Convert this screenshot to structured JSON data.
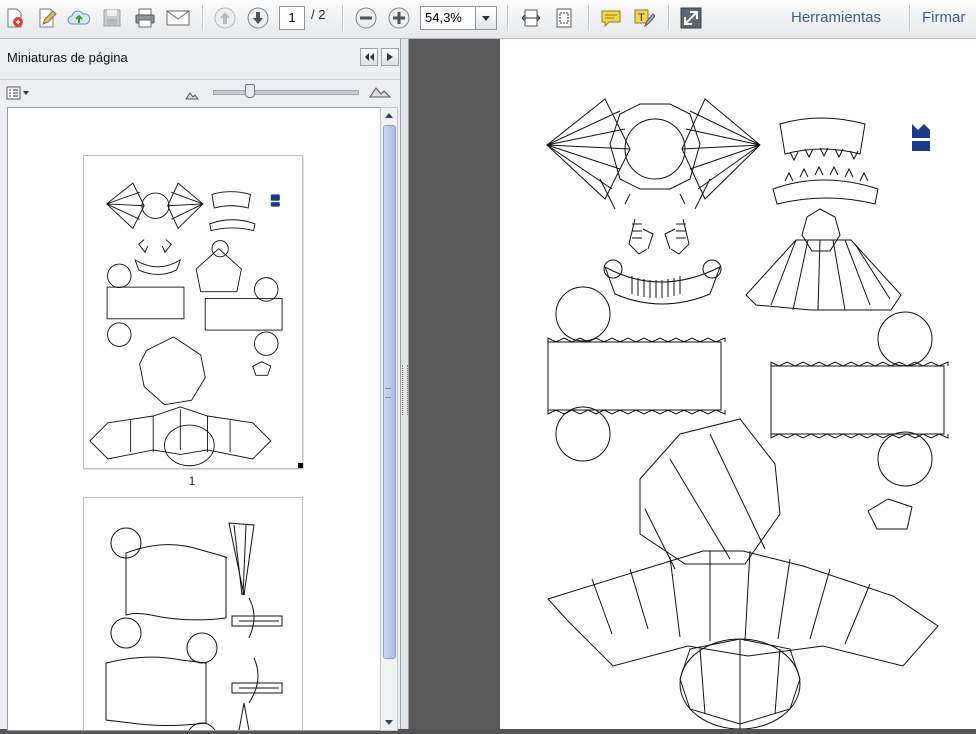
{
  "toolbar": {
    "create_icon": "create-pdf-icon",
    "edit_icon": "edit-icon",
    "upload_icon": "cloud-upload-icon",
    "save_icon": "save-icon",
    "print_icon": "print-icon",
    "email_icon": "email-icon",
    "prev_icon": "arrow-up-icon",
    "next_icon": "arrow-down-icon",
    "current_page": "1",
    "total_pages": "/ 2",
    "zoom_out_icon": "minus-icon",
    "zoom_in_icon": "plus-icon",
    "zoom_value": "54,3%",
    "tools_label": "Herramientas",
    "sign_label": "Firmar"
  },
  "sidebar": {
    "title": "Miniaturas de página",
    "thumbnails": [
      {
        "label": "1"
      },
      {
        "label": ""
      }
    ]
  }
}
